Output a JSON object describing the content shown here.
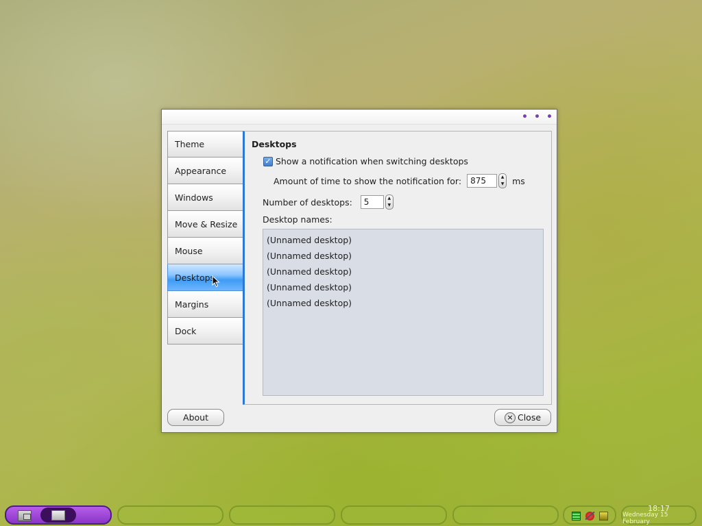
{
  "dialog": {
    "tabs": [
      {
        "label": "Theme"
      },
      {
        "label": "Appearance"
      },
      {
        "label": "Windows"
      },
      {
        "label": "Move & Resize"
      },
      {
        "label": "Mouse"
      },
      {
        "label": "Desktops",
        "active": true
      },
      {
        "label": "Margins"
      },
      {
        "label": "Dock"
      }
    ],
    "active_tab": "Desktops",
    "panel": {
      "title": "Desktops",
      "show_notification_label": "Show a notification when switching desktops",
      "show_notification_checked": true,
      "notification_time_label": "Amount of time to show the notification for:",
      "notification_time_value": "875",
      "notification_time_unit": "ms",
      "number_of_desktops_label": "Number of desktops:",
      "number_of_desktops_value": "5",
      "desktop_names_label": "Desktop names:",
      "desktop_names": [
        "(Unnamed desktop)",
        "(Unnamed desktop)",
        "(Unnamed desktop)",
        "(Unnamed desktop)",
        "(Unnamed desktop)"
      ]
    },
    "about_button": "About",
    "close_button": "Close"
  },
  "taskbar": {
    "clock_time": "18:17",
    "clock_date": "Wednesday 15 February"
  },
  "colors": {
    "accent": "#2b78d6",
    "selected_tab": "#3f9cf5",
    "launcher": "#8a35c9",
    "list_background": "#d8dde6"
  },
  "icons": [
    "window-menu-dots-icon",
    "checkbox-checked-icon",
    "spin-up-icon",
    "spin-down-icon",
    "close-icon",
    "system-icon",
    "window-icon",
    "battery-icon",
    "network-icon",
    "volume-icon",
    "mouse-cursor-icon"
  ]
}
